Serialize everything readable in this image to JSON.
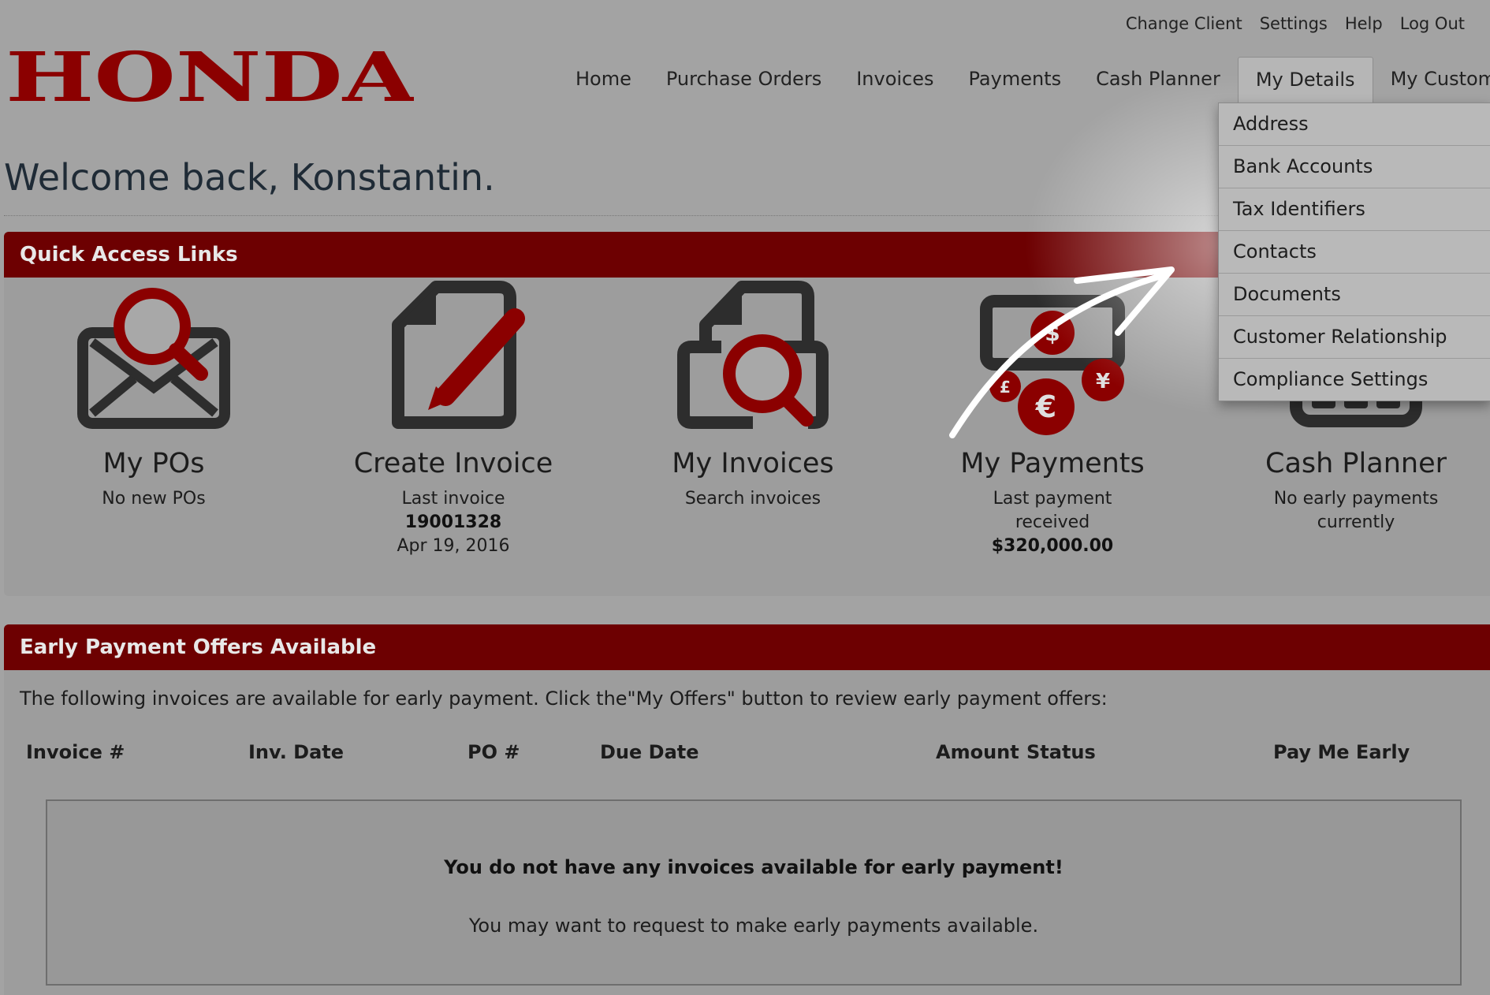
{
  "utility_nav": [
    "Change Client",
    "Settings",
    "Help",
    "Log Out"
  ],
  "logo": {
    "text": "HONDA",
    "color": "#b20000"
  },
  "main_nav": {
    "items": [
      "Home",
      "Purchase Orders",
      "Invoices",
      "Payments",
      "Cash Planner",
      "My Details",
      "My Customer"
    ],
    "active": "My Details"
  },
  "dropdown": {
    "items": [
      "Address",
      "Bank Accounts",
      "Tax Identifiers",
      "Contacts",
      "Documents",
      "Customer Relationship",
      "Compliance Settings"
    ]
  },
  "welcome": "Welcome back, Konstantin.",
  "quick_access": {
    "header": "Quick Access Links",
    "tiles": {
      "pos": {
        "title": "My POs",
        "sub": "No new POs"
      },
      "create_invoice": {
        "title": "Create Invoice",
        "sub": "Last invoice",
        "number": "19001328",
        "date": "Apr 19, 2016"
      },
      "invoices": {
        "title": "My Invoices",
        "sub": "Search invoices"
      },
      "payments": {
        "title": "My Payments",
        "sub1": "Last payment",
        "sub2": "received",
        "amount": "$320,000.00"
      },
      "cash_planner": {
        "title": "Cash Planner",
        "sub1": "No early payments",
        "sub2": "currently"
      }
    }
  },
  "early_payment": {
    "header": "Early Payment Offers Available",
    "intro": "The following invoices are available for early payment. Click the\"My Offers\" button to review early payment offers:",
    "columns": {
      "invoice": "Invoice #",
      "inv_date": "Inv. Date",
      "po": "PO #",
      "due_date": "Due Date",
      "amount": "Amount",
      "status": "Status",
      "pay_early": "Pay Me Early"
    },
    "empty_title": "You do not have any invoices available for early payment!",
    "empty_sub": "You may want to request to make early payments available."
  },
  "colors": {
    "brand_red": "#6d0001",
    "icon_red": "#8b0000",
    "icon_dark": "#2d2d2d"
  }
}
